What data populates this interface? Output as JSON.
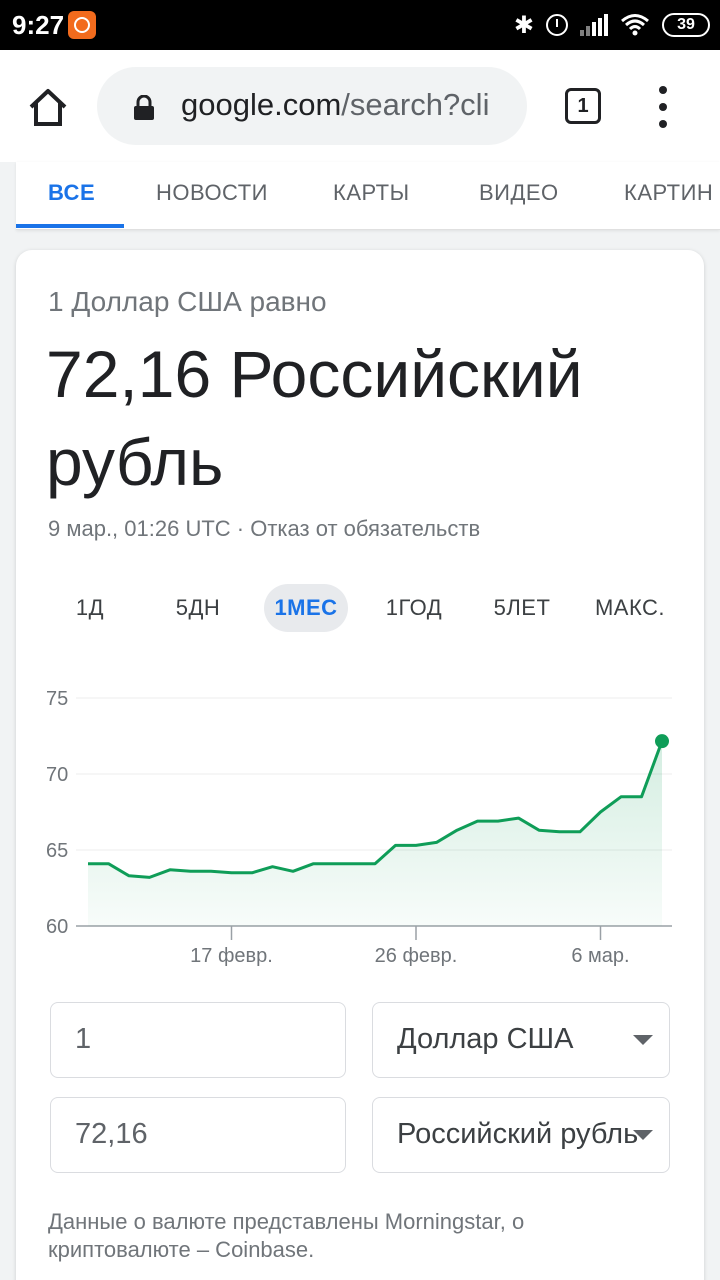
{
  "status_bar": {
    "time": "9:27",
    "battery": "39"
  },
  "browser": {
    "url_main": "google.com",
    "url_rest": "/search?cli",
    "tab_count": "1"
  },
  "search_tabs": [
    "ВСЕ",
    "НОВОСТИ",
    "КАРТЫ",
    "ВИДЕО",
    "КАРТИН"
  ],
  "converter": {
    "equals_label": "1 Доллар США равно",
    "result": "72,16 Российский рубль",
    "meta": "9 мар., 01:26 UTC · Отказ от обязательств",
    "ranges": [
      "1Д",
      "5ДН",
      "1МЕС",
      "1ГОД",
      "5ЛЕТ",
      "МАКС."
    ],
    "active_range": "1МЕС",
    "from_amount": "1",
    "from_currency": "Доллар США",
    "to_amount": "72,16",
    "to_currency": "Российский рубль",
    "source": "Данные о валюте представлены Morningstar, о криптовалюте – Coinbase."
  },
  "colors": {
    "accent": "#1a73e8",
    "line": "#0f9d58"
  },
  "icons": {
    "home": "home-icon",
    "lock": "lock-icon",
    "menu": "more-vert-icon",
    "dropdown": "dropdown-arrow-icon"
  },
  "chart_data": {
    "type": "area",
    "title": "",
    "xlabel": "",
    "ylabel": "",
    "ylim": [
      60,
      75
    ],
    "yticks": [
      75,
      70,
      65,
      60
    ],
    "x_tick_labels": [
      "17 февр.",
      "26 февр.",
      "6 мар."
    ],
    "grid": true,
    "series": [
      {
        "values": [
          64.1,
          64.1,
          63.3,
          63.2,
          63.7,
          63.6,
          63.6,
          63.5,
          63.5,
          63.9,
          63.6,
          64.1,
          64.1,
          64.1,
          64.1,
          65.3,
          65.3,
          65.5,
          66.3,
          66.9,
          66.9,
          67.1,
          66.3,
          66.2,
          66.2,
          67.5,
          68.5,
          68.5,
          72.16
        ]
      }
    ]
  }
}
